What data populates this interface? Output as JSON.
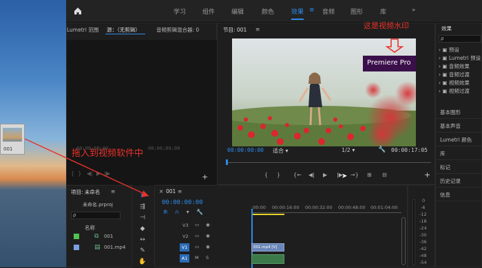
{
  "desktop": {
    "file_label": "001"
  },
  "topbar": {
    "workspaces": [
      "学习",
      "组件",
      "编辑",
      "颜色",
      "效果",
      "音频",
      "图形",
      "库"
    ],
    "more": "»",
    "active": "效果"
  },
  "source_panel": {
    "tabs": [
      "Lumetri 范围",
      "源：（无剪辑）",
      "音频剪辑混合器: 0"
    ],
    "tc_left": "00;00;00;00",
    "tc_right": "00;00;00;00"
  },
  "program": {
    "title": "节目: 001",
    "menu": "≡",
    "timecode": "00:00:00:00",
    "fit": "适合",
    "quality": "1/2",
    "duration": "00:00:17:05",
    "watermark": "Premiere Pro",
    "buttons": [
      "{",
      "}",
      "{←",
      "◀|",
      "▶",
      "|▶",
      "→}",
      "⊞",
      "⊟"
    ],
    "add": "+"
  },
  "annotations": {
    "watermark_note": "这是视频水印",
    "drag_note": "拖入到视频软件中"
  },
  "project": {
    "title": "项目: 未命名",
    "menu": "≡",
    "file": "未命名.prproj",
    "col_name": "名称",
    "items": [
      "001",
      "001.mp4"
    ]
  },
  "timeline": {
    "tab": "001",
    "menu": "≡",
    "timecode": "00:00:00:00",
    "ruler": [
      ":00:00",
      "00:00:16:00",
      "00:00:32:00",
      "00:00:48:00",
      "00:01:04:00"
    ],
    "tracks": [
      "V3",
      "V2",
      "V1",
      "A1"
    ],
    "clip_label": "001.mp4 [V]"
  },
  "meter": {
    "labels": [
      "0",
      "-6",
      "-12",
      "-18",
      "-24",
      "-30",
      "-36",
      "-42",
      "-48",
      "-54"
    ]
  },
  "effects": {
    "title": "效果",
    "search": "ρ",
    "folders": [
      "预设",
      "Lumetri 预设",
      "音频效果",
      "音频过渡",
      "视频效果",
      "视频过渡"
    ]
  },
  "side_panels": [
    "基本图形",
    "基本声音",
    "Lumetri 颜色",
    "库",
    "标记",
    "历史记录",
    "信息"
  ],
  "colors": {
    "accent": "#2d8ceb",
    "annotation": "#e8322a",
    "watermark_bg": "#3a0f4a"
  }
}
